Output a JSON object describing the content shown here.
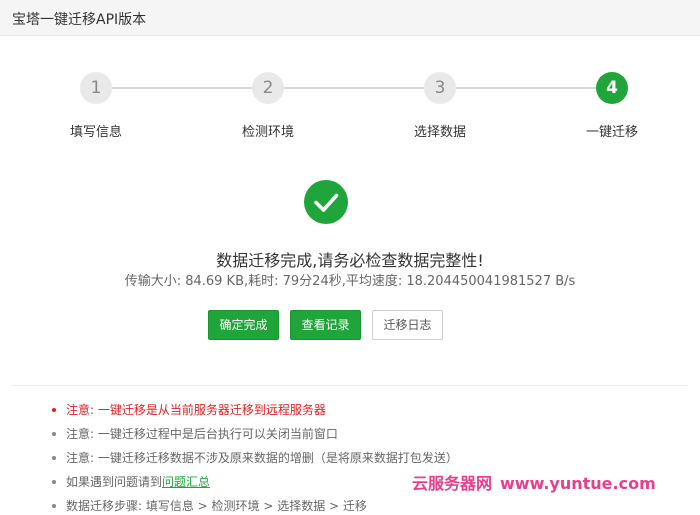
{
  "window": {
    "title": "宝塔一键迁移API版本"
  },
  "steps": [
    {
      "number": "1",
      "label": "填写信息",
      "active": false
    },
    {
      "number": "2",
      "label": "检测环境",
      "active": false
    },
    {
      "number": "3",
      "label": "选择数据",
      "active": false
    },
    {
      "number": "4",
      "label": "一键迁移",
      "active": true
    }
  ],
  "result": {
    "title": "数据迁移完成,请务必检查数据完整性!",
    "detail": "传输大小: 84.69 KB,耗时: 79分24秒,平均速度: 18.204450041981527 B/s"
  },
  "buttons": {
    "confirm": "确定完成",
    "view_log": "查看记录",
    "migrate_log": "迁移日志"
  },
  "notes": {
    "note1": "注意: 一键迁移是从当前服务器迁移到远程服务器",
    "note2": "注意: 一键迁移过程中是后台执行可以关闭当前窗口",
    "note3": "注意: 一键迁移迁移数据不涉及原来数据的增删（是将原来数据打包发送）",
    "note4_prefix": "如果遇到问题请到",
    "note4_link": "问题汇总",
    "note5": "数据迁移步骤: 填写信息 > 检测环境 > 选择数据 > 迁移"
  },
  "watermark": {
    "cn": "云服务器网",
    "url": "www.yuntue.com"
  },
  "colors": {
    "accent": "#20a53a",
    "warning": "#e02020",
    "watermark": "#e83e8c"
  }
}
